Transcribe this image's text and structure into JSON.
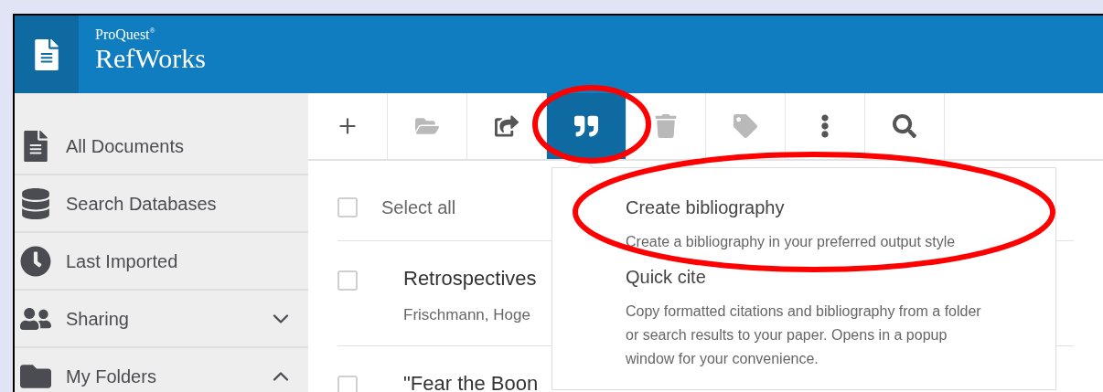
{
  "header": {
    "brand_small": "ProQuest",
    "brand_mark": "®",
    "brand": "RefWorks"
  },
  "sidebar": {
    "items": [
      {
        "kind": "document",
        "label": "All Documents"
      },
      {
        "kind": "database",
        "label": "Search Databases"
      },
      {
        "kind": "clock",
        "label": "Last Imported"
      },
      {
        "kind": "people",
        "label": "Sharing",
        "expanded": false
      },
      {
        "kind": "folder",
        "label": "My Folders",
        "expanded": true
      }
    ]
  },
  "toolbar": [
    {
      "kind": "add",
      "selected": false,
      "disabled": false
    },
    {
      "kind": "folder",
      "selected": false,
      "disabled": true
    },
    {
      "kind": "share",
      "selected": false,
      "disabled": false
    },
    {
      "kind": "cite",
      "selected": true,
      "disabled": false
    },
    {
      "kind": "delete",
      "selected": false,
      "disabled": true
    },
    {
      "kind": "tag",
      "selected": false,
      "disabled": true
    },
    {
      "kind": "more",
      "selected": false,
      "disabled": false
    },
    {
      "kind": "search",
      "selected": false,
      "disabled": false
    }
  ],
  "list": {
    "select_all": {
      "label": "Select all",
      "checked": false
    },
    "rows": [
      {
        "title": "Retrospectives",
        "authors": "Frischmann, Hoge",
        "checked": false
      },
      {
        "title": "\"Fear the Boon",
        "checked": false
      }
    ]
  },
  "menu": {
    "items": [
      {
        "title": "Create bibliography",
        "description": "Create a bibliography in your preferred output style"
      },
      {
        "title": "Quick cite",
        "description": "Copy formatted citations and bibliography from a folder or search results to your paper. Opens in a popup window for your convenience."
      }
    ]
  },
  "annotations": [
    {
      "kind": "ellipse",
      "color": "#ff0000"
    },
    {
      "kind": "ellipse",
      "color": "#ff0000"
    }
  ]
}
